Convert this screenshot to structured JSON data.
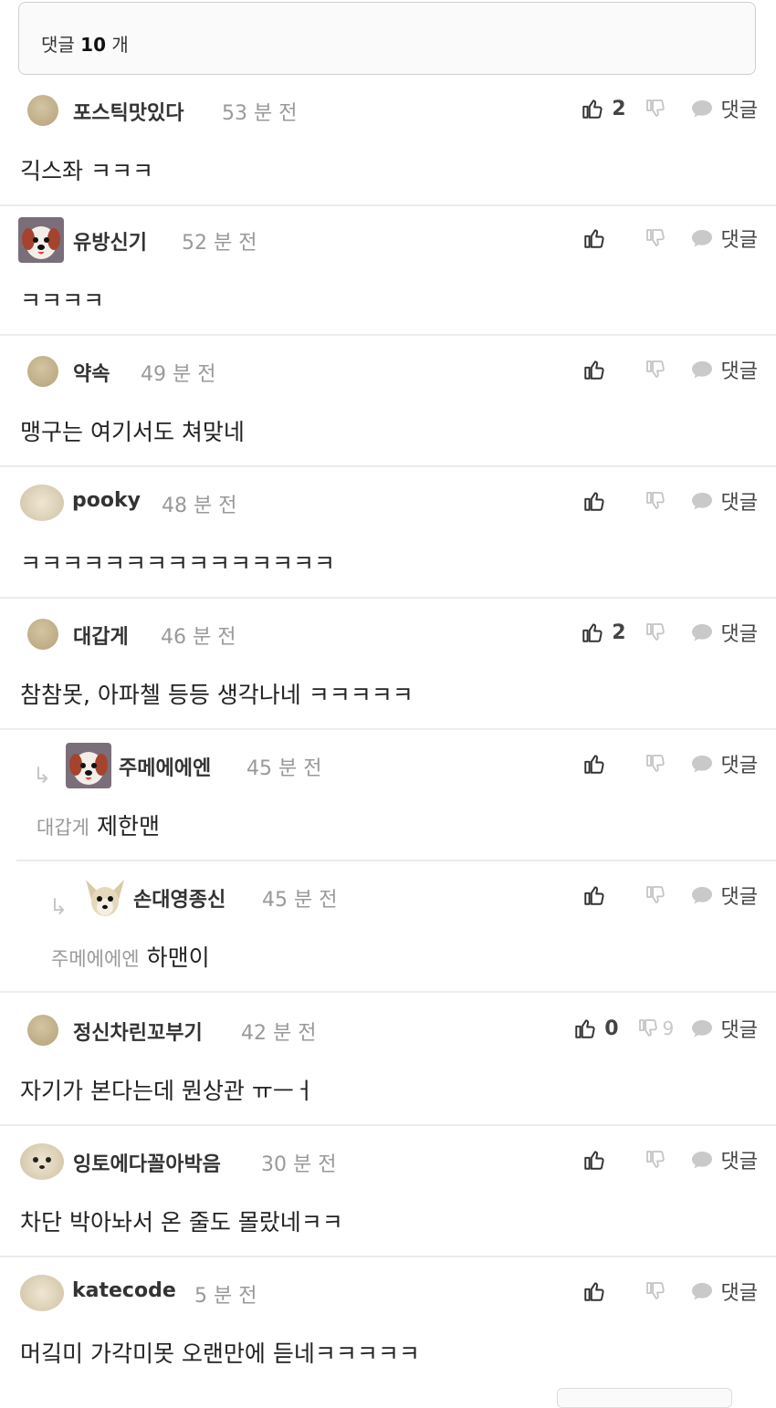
{
  "header": {
    "label": "댓글",
    "count": "10",
    "suffix": "개"
  },
  "reply_label": "댓글",
  "comments": [
    {
      "username": "포스틱맛있다",
      "time": "53 분 전",
      "likes": "2",
      "dislikes": "",
      "text": "긱스좌 ㅋㅋㅋ",
      "mention": ""
    },
    {
      "username": "유방신기",
      "time": "52 분 전",
      "likes": "",
      "dislikes": "",
      "text": "ㅋㅋㅋㅋ",
      "mention": ""
    },
    {
      "username": "약속",
      "time": "49 분 전",
      "likes": "",
      "dislikes": "",
      "text": "맹구는 여기서도 쳐맞네",
      "mention": ""
    },
    {
      "username": "pooky",
      "time": "48 분 전",
      "likes": "",
      "dislikes": "",
      "text": "ㅋㅋㅋㅋㅋㅋㅋㅋㅋㅋㅋㅋㅋㅋㅋ",
      "mention": ""
    },
    {
      "username": "대갑게",
      "time": "46 분 전",
      "likes": "2",
      "dislikes": "",
      "text": "참참못, 아파첼 등등 생각나네 ㅋㅋㅋㅋㅋ",
      "mention": ""
    },
    {
      "username": "주메에에엔",
      "time": "45 분 전",
      "likes": "",
      "dislikes": "",
      "text": "제한맨",
      "mention": "대갑게"
    },
    {
      "username": "손대영종신",
      "time": "45 분 전",
      "likes": "",
      "dislikes": "",
      "text": "하맨이",
      "mention": "주메에에엔"
    },
    {
      "username": "정신차린꼬부기",
      "time": "42 분 전",
      "likes": "0",
      "dislikes": "9",
      "text": "자기가 본다는데 뭔상관 ㅠㅡㅓ",
      "mention": ""
    },
    {
      "username": "잉토에다꼴아박음",
      "time": "30 분 전",
      "likes": "",
      "dislikes": "",
      "text": "차단 박아놔서 온 줄도 몰랐네ㅋㅋ",
      "mention": ""
    },
    {
      "username": "katecode",
      "time": "5 분 전",
      "likes": "",
      "dislikes": "",
      "text": "머깈미 가각미못 오랜만에 듣네ㅋㅋㅋㅋㅋ",
      "mention": ""
    }
  ]
}
